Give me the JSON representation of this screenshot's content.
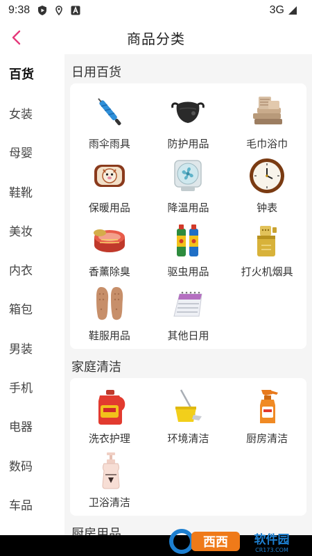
{
  "status": {
    "time": "9:38",
    "network": "3G"
  },
  "header": {
    "title": "商品分类"
  },
  "sidebar": {
    "items": [
      {
        "label": "百货"
      },
      {
        "label": "女装"
      },
      {
        "label": "母婴"
      },
      {
        "label": "鞋靴"
      },
      {
        "label": "美妆"
      },
      {
        "label": "内衣"
      },
      {
        "label": "箱包"
      },
      {
        "label": "男装"
      },
      {
        "label": "手机"
      },
      {
        "label": "电器"
      },
      {
        "label": "数码"
      },
      {
        "label": "车品"
      }
    ],
    "active_index": 0
  },
  "sections": [
    {
      "title": "日用百货",
      "items": [
        {
          "label": "雨伞雨具",
          "icon": "umbrella-icon"
        },
        {
          "label": "防护用品",
          "icon": "face-mask-icon"
        },
        {
          "label": "毛巾浴巾",
          "icon": "towel-icon"
        },
        {
          "label": "保暖用品",
          "icon": "hand-warmer-icon"
        },
        {
          "label": "降温用品",
          "icon": "fan-icon"
        },
        {
          "label": "钟表",
          "icon": "clock-icon"
        },
        {
          "label": "香薰除臭",
          "icon": "aroma-tin-icon"
        },
        {
          "label": "驱虫用品",
          "icon": "insect-spray-icon"
        },
        {
          "label": "打火机烟具",
          "icon": "lighter-icon"
        },
        {
          "label": "鞋服用品",
          "icon": "insoles-icon"
        },
        {
          "label": "其他日用",
          "icon": "desk-calendar-icon"
        }
      ]
    },
    {
      "title": "家庭清洁",
      "items": [
        {
          "label": "洗衣护理",
          "icon": "detergent-bottle-icon"
        },
        {
          "label": "环境清洁",
          "icon": "mop-bucket-icon"
        },
        {
          "label": "厨房清洁",
          "icon": "spray-bottle-icon"
        },
        {
          "label": "卫浴清洁",
          "icon": "pump-bottle-icon"
        }
      ]
    },
    {
      "title": "厨房用品",
      "items": []
    }
  ],
  "colors": {
    "accent": "#e5387a",
    "background": "#f5f5f5",
    "card": "#ffffff"
  },
  "watermark": {
    "brand": "西西软件园",
    "domain": "CR173.COM"
  }
}
